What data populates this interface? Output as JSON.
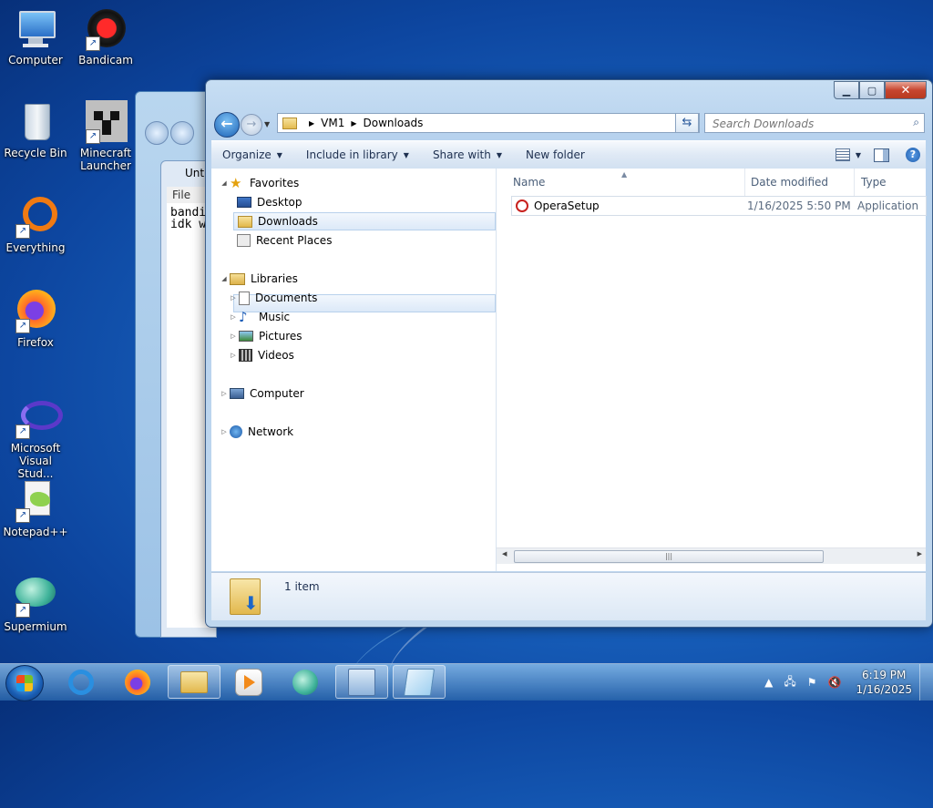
{
  "desktop": {
    "icons": [
      {
        "label": "Computer"
      },
      {
        "label": "Bandicam"
      },
      {
        "label": "Recycle Bin"
      },
      {
        "label": "Minecraft Launcher"
      },
      {
        "label": "Everything"
      },
      {
        "label": "Firefox"
      },
      {
        "label": "Microsoft Visual Stud..."
      },
      {
        "label": "Notepad++"
      },
      {
        "label": "Supermium"
      }
    ]
  },
  "notepad": {
    "title": "Unt",
    "menu_file": "File",
    "text": "bandi\nidk w"
  },
  "explorer": {
    "address": {
      "part1": "VM1",
      "part2": "Downloads"
    },
    "search": {
      "placeholder": "Search Downloads"
    },
    "toolbar": {
      "organize": "Organize",
      "include_in_library": "Include in library",
      "share_with": "Share with",
      "new_folder": "New folder"
    },
    "nav": {
      "favorites": "Favorites",
      "desktop": "Desktop",
      "downloads": "Downloads",
      "recent_places": "Recent Places",
      "libraries": "Libraries",
      "documents": "Documents",
      "music": "Music",
      "pictures": "Pictures",
      "videos": "Videos",
      "computer": "Computer",
      "network": "Network"
    },
    "columns": {
      "name": "Name",
      "date_modified": "Date modified",
      "type": "Type"
    },
    "files": [
      {
        "name": "OperaSetup",
        "date": "1/16/2025 5:50 PM",
        "type": "Application"
      }
    ],
    "status": {
      "item_count": "1 item"
    }
  },
  "taskbar": {
    "clock_time": "6:19 PM",
    "clock_date": "1/16/2025"
  },
  "colors": {
    "accent": "#1a66c2",
    "selection": "#dce9f8"
  }
}
